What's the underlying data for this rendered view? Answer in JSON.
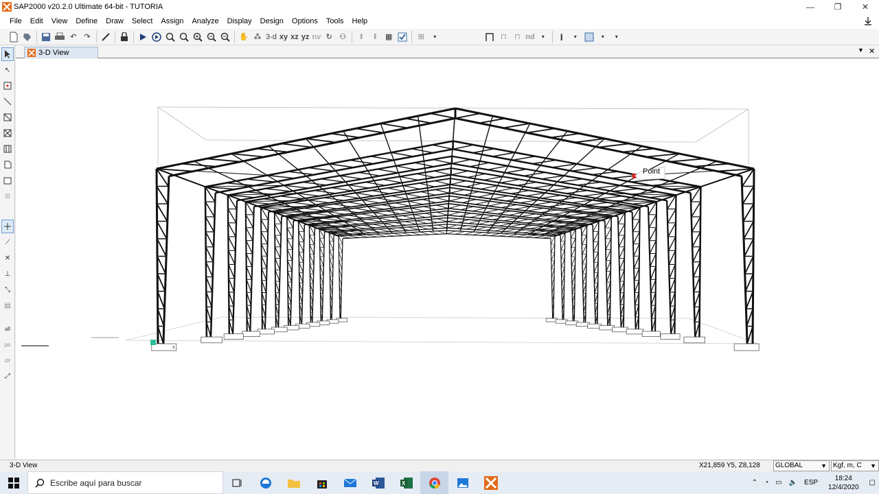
{
  "window": {
    "title": "SAP2000 v20.2.0 Ultimate 64-bit - TUTORIA",
    "minimize": "—",
    "restore": "❐",
    "close": "✕"
  },
  "menu": [
    "File",
    "Edit",
    "View",
    "Define",
    "Draw",
    "Select",
    "Assign",
    "Analyze",
    "Display",
    "Design",
    "Options",
    "Tools",
    "Help"
  ],
  "toolbar": {
    "view_3d": "3-d",
    "view_xy": "xy",
    "view_xz": "xz",
    "view_yz": "yz",
    "view_nv": "nv",
    "nd": "nd"
  },
  "view_tab": {
    "label": "3-D View"
  },
  "canvas": {
    "tooltip": "Point",
    "axis_label": "x"
  },
  "status": {
    "view_name": "3-D View",
    "coords": "X21,859  Y5,  Z8,128",
    "coord_system": "GLOBAL",
    "units": "Kgf, m, C"
  },
  "taskbar": {
    "search_placeholder": "Escribe aquí para buscar",
    "language": "ESP",
    "time": "18:24",
    "date": "12/4/2020"
  }
}
